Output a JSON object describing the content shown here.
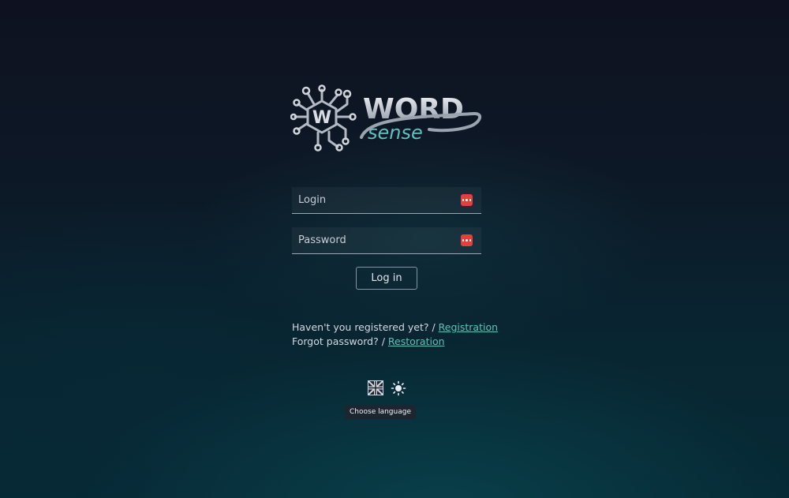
{
  "logo": {
    "word": "WORD",
    "sense": "sense",
    "badge": "W"
  },
  "login_form": {
    "login_placeholder": "Login",
    "login_value": "",
    "password_placeholder": "Password",
    "password_value": "",
    "submit_label": "Log in"
  },
  "links": {
    "register_prompt": "Haven't you registered yet? / ",
    "register_link": "Registration",
    "forgot_prompt": "Forgot password? / ",
    "restore_link": "Restoration"
  },
  "footer": {
    "language_icon": "uk-flag-icon",
    "theme_icon": "sun-icon",
    "tooltip": "Choose language"
  },
  "colors": {
    "accent": "#5cc2b8",
    "password_manager": "#e2413b"
  }
}
